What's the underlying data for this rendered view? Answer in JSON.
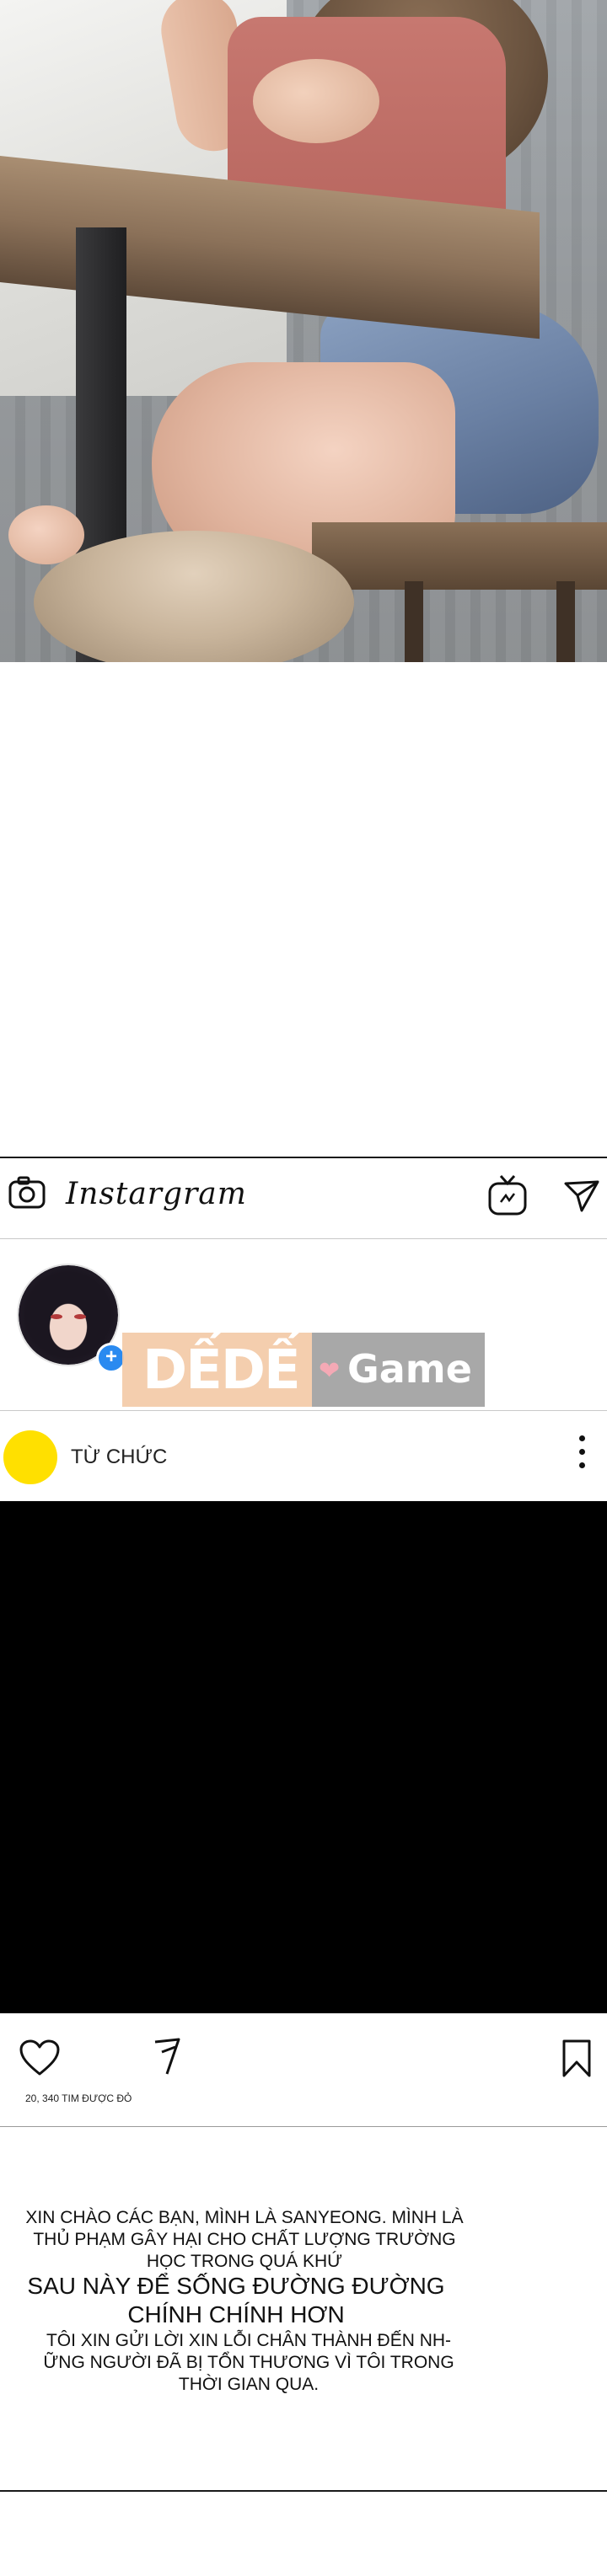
{
  "app": {
    "brand": "Instargram",
    "icons": [
      "camera-icon",
      "igtv-icon",
      "send-icon"
    ]
  },
  "watermark": {
    "left_text": "DẾDẾ",
    "right_text": "Game"
  },
  "post": {
    "username": "TỪ CHỨC",
    "avatar_color": "#ffe000",
    "likes_text": "20, 340 TIM ĐƯỢC ĐỎ"
  },
  "caption": {
    "line1": "XIN CHÀO CÁC BẠN, MÌNH LÀ SANYEONG. MÌNH LÀ",
    "line2": "THỦ PHẠM GÂY HẠI CHO CHẤT LƯỢNG TRƯỜNG",
    "line3": "HỌC TRONG QUÁ KHỨ",
    "line4": "SAU NÀY ĐỂ SỐNG ĐƯỜNG ĐƯỜNG",
    "line5": "CHÍNH CHÍNH HƠN",
    "line6": "TÔI XIN GỬI LỜI XIN LỖI CHÂN THÀNH ĐẾN NH-",
    "line7": "ỮNG NGƯỜI ĐÃ BỊ TỔN THƯƠNG VÌ TÔI TRONG",
    "line8": "THỜI GIAN QUA."
  }
}
